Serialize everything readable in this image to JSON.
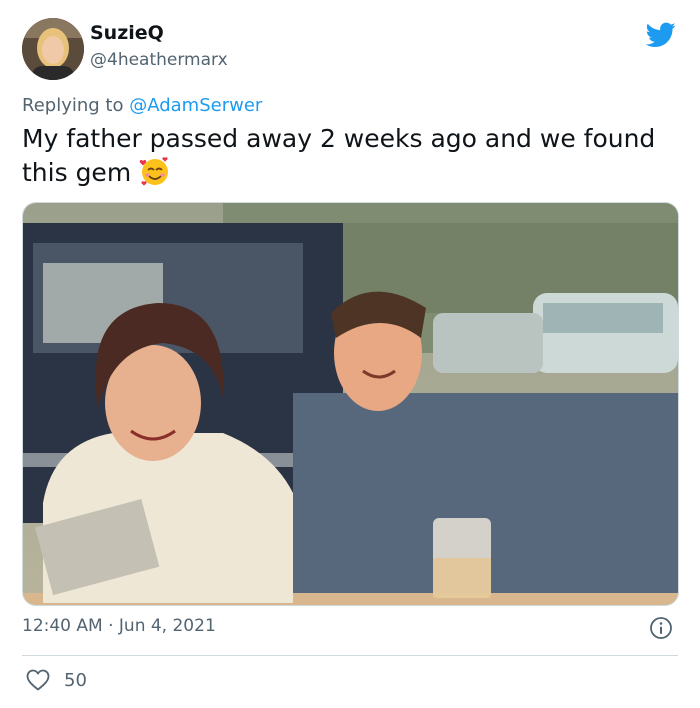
{
  "tweet": {
    "display_name": "SuzieQ",
    "handle": "@4heathermarx",
    "reply_prefix": "Replying to",
    "reply_to": "@AdamSerwer",
    "text": "My father passed away 2 weeks ago and we found this gem",
    "emoji": "smiling-face-with-hearts",
    "timestamp": "12:40 AM · Jun 4, 2021",
    "like_count": "50"
  },
  "colors": {
    "brand": "#1d9bf0",
    "secondary_text": "#536471",
    "primary_text": "#0f1419",
    "divider": "#cfd9de"
  },
  "icons": [
    "twitter-bird-icon",
    "info-icon",
    "heart-icon",
    "smiling-face-with-hearts-emoji"
  ]
}
